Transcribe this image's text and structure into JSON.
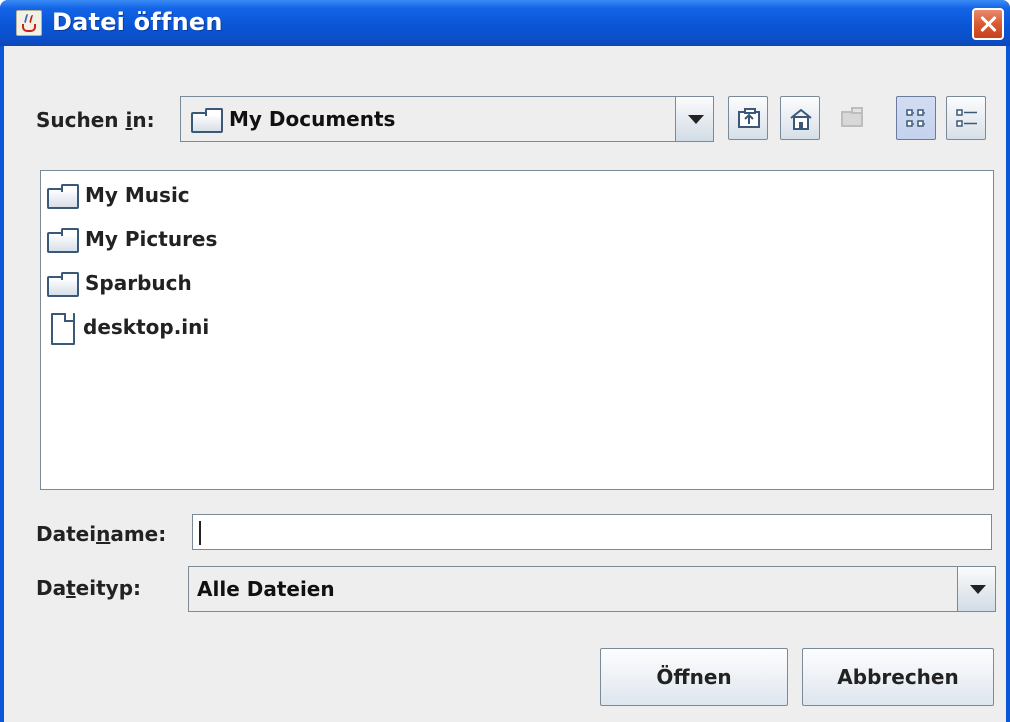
{
  "window": {
    "title": "Datei öffnen"
  },
  "lookin": {
    "label_pre": "Suchen ",
    "label_u": "i",
    "label_post": "n:",
    "value": "My Documents"
  },
  "toolbar": {
    "icons": [
      "up-one-level-icon",
      "home-icon",
      "new-folder-icon",
      "list-view-icon",
      "details-view-icon"
    ]
  },
  "files": [
    {
      "name": "My Music",
      "type": "folder"
    },
    {
      "name": "My Pictures",
      "type": "folder"
    },
    {
      "name": "Sparbuch",
      "type": "folder"
    },
    {
      "name": "desktop.ini",
      "type": "file"
    }
  ],
  "filename": {
    "label_pre": "Datei",
    "label_u": "n",
    "label_post": "ame:",
    "value": ""
  },
  "filetype": {
    "label_pre": "Da",
    "label_u": "t",
    "label_post": "eityp:",
    "value": "Alle Dateien"
  },
  "buttons": {
    "open": "Öffnen",
    "cancel": "Abbrechen"
  }
}
